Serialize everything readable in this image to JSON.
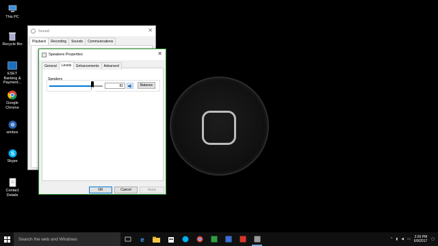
{
  "desktop": {
    "icons": [
      {
        "label": "This PC"
      },
      {
        "label": "Recycle Bin"
      },
      {
        "label": "ESET Banking & Payment..."
      },
      {
        "label": "Google Chrome"
      },
      {
        "label": "winbox"
      },
      {
        "label": "Skype"
      },
      {
        "label": "Contact Details"
      }
    ]
  },
  "sound_window": {
    "title": "Sound",
    "tabs": [
      "Playback",
      "Recording",
      "Sounds",
      "Communications"
    ],
    "active_tab": "Playback"
  },
  "speakers_window": {
    "title": "Speakers Properties",
    "tabs": [
      "General",
      "Levels",
      "Enhancements",
      "Advanced"
    ],
    "active_tab": "Levels",
    "device_label": "Speakers",
    "level_value": "81",
    "level_fraction": 0.81,
    "balance_label": "Balance",
    "ok_label": "OK",
    "cancel_label": "Cancel",
    "apply_label": "Apply"
  },
  "taskbar": {
    "search_placeholder": "Search the web and Windows",
    "clock_time": "2:26 PM",
    "clock_date": "6/9/2017"
  },
  "colors": {
    "accent": "#0078d7",
    "window_border": "#2b8a2b"
  }
}
